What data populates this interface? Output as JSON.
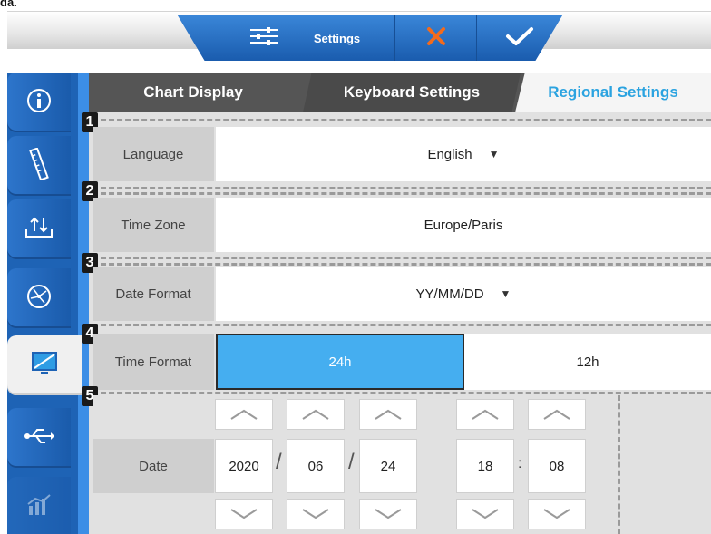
{
  "corner_text": "da.",
  "toolbar": {
    "settings_label": "Settings"
  },
  "tabs": [
    "Chart Display",
    "Keyboard Settings",
    "Regional Settings"
  ],
  "badges": [
    "1",
    "2",
    "3",
    "4",
    "5"
  ],
  "language": {
    "label": "Language",
    "value": "English"
  },
  "time_zone": {
    "label": "Time Zone",
    "value": "Europe/Paris"
  },
  "date_format": {
    "label": "Date Format",
    "value": "YY/MM/DD"
  },
  "time_format": {
    "label": "Time Format",
    "options": [
      "24h",
      "12h"
    ],
    "selected": "24h"
  },
  "date": {
    "label": "Date",
    "year": "2020",
    "month": "06",
    "day": "24",
    "date_sep": "/",
    "hour": "18",
    "minute": "08",
    "time_sep": ":"
  },
  "sidebar_icons": [
    "info-icon",
    "ruler-icon",
    "upload-download-icon",
    "globe-icon",
    "monitor-icon",
    "usb-icon",
    "chart-icon"
  ],
  "colors": {
    "primary": "#1e63b5",
    "accent": "#45aef0",
    "cancel": "#f26b1d",
    "active_tab_text": "#2ba3e0"
  }
}
